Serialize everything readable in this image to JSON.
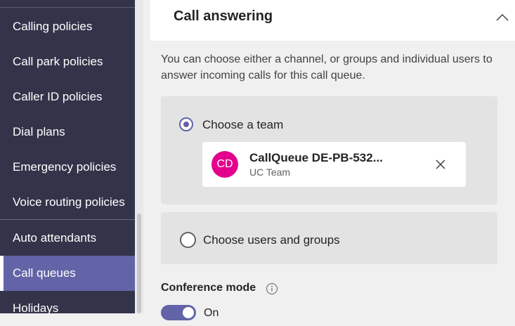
{
  "sidebar": {
    "items": [
      {
        "label": "Calling policies"
      },
      {
        "label": "Call park policies"
      },
      {
        "label": "Caller ID policies"
      },
      {
        "label": "Dial plans"
      },
      {
        "label": "Emergency policies"
      },
      {
        "label": "Voice routing policies"
      },
      {
        "label": "Auto attendants"
      },
      {
        "label": "Call queues",
        "selected": true
      },
      {
        "label": "Holidays"
      }
    ]
  },
  "section": {
    "title": "Call answering",
    "collapse_icon": "chevron-up-icon",
    "description": "You can choose either a channel, or groups and individual users to answer incoming calls for this call queue."
  },
  "options": {
    "team": {
      "label": "Choose a team",
      "checked": true
    },
    "users": {
      "label": "Choose users and groups",
      "checked": false
    }
  },
  "team_card": {
    "initials": "CD",
    "name": "CallQueue DE-PB-532...",
    "subtitle": "UC Team",
    "avatar_color": "#e3008c",
    "remove_icon": "close-icon"
  },
  "conference": {
    "label": "Conference mode",
    "info_icon": "info-icon",
    "toggle_on": true,
    "toggle_label": "On"
  },
  "colors": {
    "sidebar_bg": "#33344a",
    "accent": "#6264a7"
  }
}
